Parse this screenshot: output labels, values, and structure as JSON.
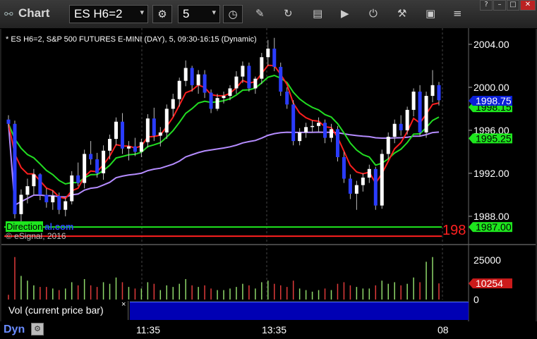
{
  "window": {
    "title": "Chart",
    "symbol": "ES H6=2",
    "interval": "5"
  },
  "chart": {
    "header": "* ES H6=2, S&P 500 FUTURES E-MINI (DAY), 5, 09:30-16:15 (Dynamic)",
    "copyright": "© eSignal, 2016",
    "overlay_label_highlight": "Direction",
    "overlay_label_site": "al.com",
    "cut_price": "198",
    "price_ticks": [
      "2004.00",
      "2000.00",
      "1996.00",
      "1992.00",
      "1988.00"
    ],
    "badges": {
      "last": "1998.75",
      "ema": "1998.15",
      "vwap": "1995.25",
      "level": "1987.00"
    },
    "volume_ticks": [
      "25000",
      "0"
    ],
    "volume_badge": "10254",
    "volume_label": "Vol (current price bar)",
    "volume_close": "×",
    "colors": {
      "up": "#ffffff",
      "down": "#2a3cff",
      "ema_fast": "#ff1f1f",
      "ema_slow": "#22dd22",
      "vwap": "#b58cff",
      "level_green": "#1ee61e",
      "level_red": "#ff1f1f",
      "vol_up": "#8fd96a",
      "vol_down": "#e03a3a"
    }
  },
  "time_axis": [
    "11:35",
    "13:35",
    "08"
  ],
  "bottom": {
    "mode": "Dyn"
  },
  "chart_data": {
    "type": "candlestick",
    "x_ticks": [
      "11:35",
      "13:35",
      "08"
    ],
    "ylim": [
      1985.5,
      2005.5
    ],
    "y_ticks": [
      2004,
      2000,
      1996,
      1992,
      1988
    ],
    "candles": [
      [
        1997.0,
        1997.4,
        1996.2,
        1996.6
      ],
      [
        1996.6,
        1996.9,
        1987.8,
        1988.2
      ],
      [
        1988.2,
        1990.5,
        1987.5,
        1990.0
      ],
      [
        1990.0,
        1991.5,
        1989.2,
        1990.8
      ],
      [
        1990.8,
        1992.4,
        1990.0,
        1991.9
      ],
      [
        1991.9,
        1992.0,
        1989.5,
        1990.0
      ],
      [
        1990.0,
        1990.6,
        1988.8,
        1989.3
      ],
      [
        1989.3,
        1990.4,
        1988.6,
        1989.9
      ],
      [
        1989.9,
        1990.2,
        1988.2,
        1988.6
      ],
      [
        1988.6,
        1989.7,
        1988.0,
        1989.4
      ],
      [
        1989.4,
        1992.2,
        1989.1,
        1991.8
      ],
      [
        1991.8,
        1993.0,
        1990.8,
        1991.1
      ],
      [
        1991.1,
        1994.2,
        1990.6,
        1993.8
      ],
      [
        1993.8,
        1995.0,
        1992.8,
        1993.3
      ],
      [
        1993.3,
        1993.9,
        1991.6,
        1992.0
      ],
      [
        1992.0,
        1994.6,
        1991.4,
        1994.1
      ],
      [
        1994.1,
        1995.6,
        1993.3,
        1995.2
      ],
      [
        1995.2,
        1997.2,
        1994.6,
        1996.8
      ],
      [
        1996.8,
        1997.6,
        1993.8,
        1994.3
      ],
      [
        1994.3,
        1995.0,
        1993.2,
        1994.5
      ],
      [
        1994.5,
        1995.3,
        1993.6,
        1994.0
      ],
      [
        1994.0,
        1995.2,
        1993.5,
        1994.9
      ],
      [
        1994.9,
        1997.5,
        1994.4,
        1997.1
      ],
      [
        1997.1,
        1998.1,
        1995.0,
        1995.5
      ],
      [
        1995.5,
        1996.3,
        1994.5,
        1995.8
      ],
      [
        1995.8,
        1998.4,
        1995.2,
        1998.0
      ],
      [
        1998.0,
        1999.4,
        1997.3,
        1998.9
      ],
      [
        1998.9,
        2000.9,
        1998.2,
        2000.6
      ],
      [
        2000.6,
        2002.5,
        2000.1,
        2001.8
      ],
      [
        2001.8,
        2002.0,
        1999.6,
        2000.2
      ],
      [
        2000.2,
        2001.6,
        1999.4,
        2001.2
      ],
      [
        2001.2,
        2001.6,
        1999.0,
        1999.5
      ],
      [
        1999.5,
        1999.8,
        1997.6,
        1998.0
      ],
      [
        1998.0,
        1999.4,
        1997.8,
        1999.0
      ],
      [
        1999.0,
        1999.6,
        1998.5,
        1999.2
      ],
      [
        1999.2,
        2000.2,
        1998.8,
        1999.9
      ],
      [
        1999.9,
        2001.5,
        1999.4,
        2001.0
      ],
      [
        2001.0,
        2002.4,
        2000.4,
        2002.0
      ],
      [
        2002.0,
        2002.3,
        1999.6,
        1999.9
      ],
      [
        1999.9,
        2001.0,
        1999.4,
        2000.8
      ],
      [
        2000.8,
        2003.2,
        2000.3,
        2002.8
      ],
      [
        2002.8,
        2004.4,
        2002.0,
        2003.6
      ],
      [
        2003.6,
        2004.6,
        2001.5,
        2001.9
      ],
      [
        2001.9,
        2002.3,
        1999.2,
        1999.6
      ],
      [
        1999.6,
        2000.0,
        1998.0,
        1998.4
      ],
      [
        1998.4,
        1998.8,
        1994.6,
        1995.0
      ],
      [
        1995.0,
        1996.2,
        1994.6,
        1995.8
      ],
      [
        1995.8,
        1996.7,
        1995.3,
        1996.3
      ],
      [
        1996.3,
        1996.9,
        1995.8,
        1996.4
      ],
      [
        1996.4,
        1997.2,
        1995.8,
        1996.7
      ],
      [
        1996.7,
        1997.0,
        1994.8,
        1995.3
      ],
      [
        1995.3,
        1996.6,
        1994.9,
        1996.1
      ],
      [
        1996.1,
        1996.4,
        1993.1,
        1993.5
      ],
      [
        1993.5,
        1994.0,
        1991.1,
        1991.5
      ],
      [
        1991.5,
        1991.9,
        1989.6,
        1990.1
      ],
      [
        1990.1,
        1991.3,
        1988.6,
        1990.9
      ],
      [
        1990.9,
        1992.0,
        1990.3,
        1991.6
      ],
      [
        1991.6,
        1992.8,
        1991.1,
        1992.4
      ],
      [
        1992.4,
        1992.6,
        1988.6,
        1989.0
      ],
      [
        1989.0,
        1994.2,
        1988.7,
        1993.8
      ],
      [
        1993.8,
        1995.8,
        1993.3,
        1995.4
      ],
      [
        1995.4,
        1997.0,
        1994.8,
        1996.6
      ],
      [
        1996.6,
        1997.4,
        1995.5,
        1996.0
      ],
      [
        1996.0,
        1998.2,
        1995.6,
        1997.9
      ],
      [
        1997.9,
        1999.9,
        1997.3,
        1999.6
      ],
      [
        1999.6,
        2000.2,
        1995.4,
        1995.8
      ],
      [
        1995.8,
        1999.6,
        1995.3,
        1999.2
      ],
      [
        1999.2,
        2001.6,
        1998.6,
        2000.2
      ],
      [
        2000.2,
        2000.5,
        1998.3,
        1998.8
      ]
    ],
    "volume_ylim": [
      0,
      30000
    ],
    "volume_ticks": [
      25000,
      0
    ],
    "volume": [
      3000,
      27000,
      15000,
      12000,
      9000,
      8000,
      8000,
      7000,
      6000,
      7000,
      11000,
      9000,
      13000,
      9000,
      8000,
      11000,
      10000,
      14000,
      11000,
      8000,
      7000,
      7000,
      11000,
      10000,
      6000,
      9000,
      8000,
      10000,
      13000,
      9000,
      8000,
      9000,
      7000,
      6000,
      6000,
      7000,
      8000,
      10000,
      9000,
      7000,
      11000,
      12000,
      10000,
      9000,
      8000,
      12000,
      7000,
      6000,
      5000,
      6000,
      7000,
      6000,
      10000,
      11000,
      9000,
      8000,
      7000,
      7000,
      9000,
      12000,
      10000,
      11000,
      9000,
      10000,
      14000,
      11000,
      24000,
      27000,
      10254
    ]
  }
}
